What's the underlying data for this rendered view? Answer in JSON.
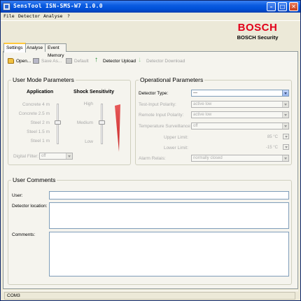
{
  "window": {
    "title": "SensTool ISN-SMS-W7 1.0.0"
  },
  "menu": [
    "File",
    "Detector",
    "Analyse",
    "?"
  ],
  "brand": {
    "logo": "BOSCH",
    "subtitle": "BOSCH Security"
  },
  "tabs": [
    {
      "label": "Settings",
      "active": true
    },
    {
      "label": "Analyse",
      "active": false
    },
    {
      "label": "Event Memory",
      "active": false
    }
  ],
  "toolbar": {
    "open": "Open...",
    "save_as": "Save As...",
    "default": "Default",
    "upload": "Detector Upload",
    "download": "Detector Download"
  },
  "user_mode": {
    "title": "User Mode Parameters",
    "application_header": "Application",
    "application_levels": [
      "Concrete 4 m",
      "Concrete 2.5 m",
      "Steel 2 m",
      "Steel 1.5 m",
      "Steel 1 m"
    ],
    "application_selected": "Steel 2 m",
    "shock_header": "Shock Sensitivity",
    "shock_levels": [
      "High",
      "Medium",
      "Low"
    ],
    "shock_selected": "Medium",
    "digital_filter_label": "Digital Filter:",
    "digital_filter_value": "off"
  },
  "operational": {
    "title": "Operational Parameters",
    "detector_type_label": "Detector Type:",
    "detector_type_value": "---",
    "test_input_label": "Test-Input Polarity:",
    "test_input_value": "active low",
    "remote_input_label": "Remote Input Polarity:",
    "remote_input_value": "active low",
    "temp_surv_label": "Temperature Surveillance:",
    "temp_surv_value": "off",
    "upper_limit_label": "Upper Limit:",
    "upper_limit_value": "85 °C",
    "lower_limit_label": "Lower Limit:",
    "lower_limit_value": "-15 °C",
    "alarm_relais_label": "Alarm Relais:",
    "alarm_relais_value": "normally closed"
  },
  "comments": {
    "title": "User Comments",
    "user_label": "User:",
    "location_label": "Detector location:",
    "comments_label": "Comments:"
  },
  "status": {
    "port": "COM3"
  },
  "colors": {
    "title_blue": "#0050d8",
    "bosch_red": "#e2001a",
    "accent_orange": "#ffc83c"
  }
}
